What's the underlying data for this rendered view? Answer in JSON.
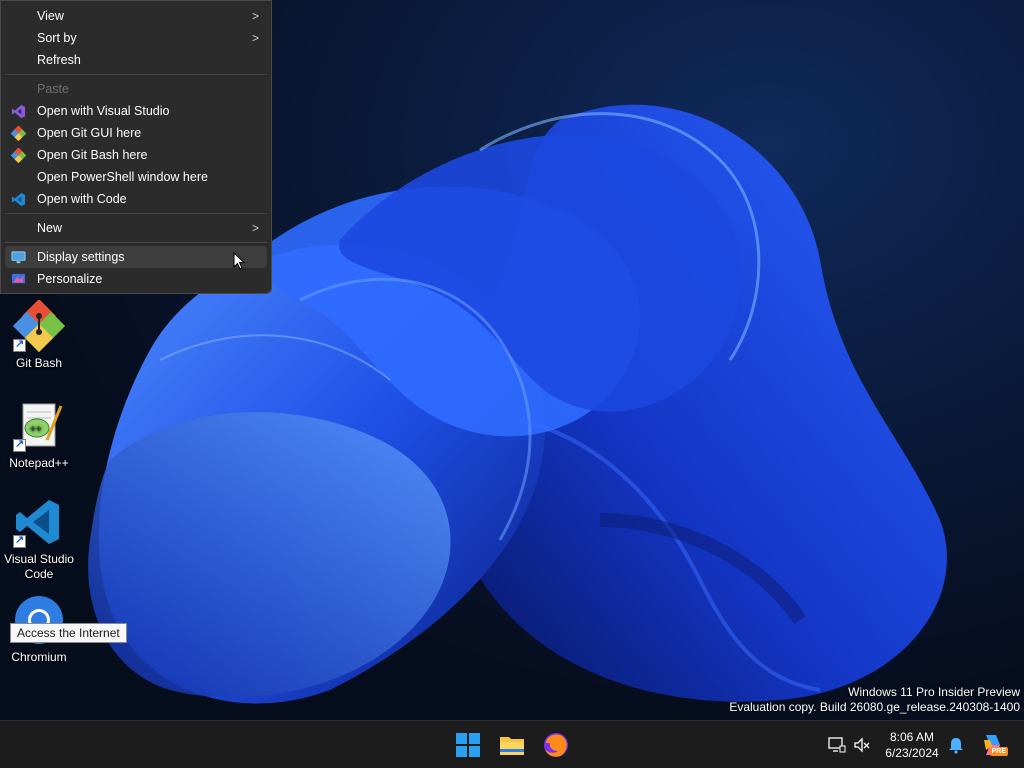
{
  "context_menu": {
    "items": [
      {
        "label": "View",
        "submenu": true
      },
      {
        "label": "Sort by",
        "submenu": true
      },
      {
        "label": "Refresh"
      },
      {
        "label": "Paste",
        "disabled": true
      },
      {
        "label": "Open with Visual Studio",
        "icon": "visual-studio-icon"
      },
      {
        "label": "Open Git GUI here",
        "icon": "git-icon"
      },
      {
        "label": "Open Git Bash here",
        "icon": "git-icon"
      },
      {
        "label": "Open PowerShell window here"
      },
      {
        "label": "Open with Code",
        "icon": "vscode-icon"
      },
      {
        "label": "New",
        "submenu": true
      },
      {
        "label": "Display settings",
        "icon": "display-icon",
        "hovered": true
      },
      {
        "label": "Personalize",
        "icon": "personalize-icon"
      }
    ],
    "submenu_arrow": ">"
  },
  "desktop_icons": [
    {
      "label": "Git Bash",
      "icon": "git-bash-icon"
    },
    {
      "label": "Notepad++",
      "icon": "notepad-plus-plus-icon"
    },
    {
      "label": "Visual Studio Code",
      "icon": "vscode-icon"
    },
    {
      "label": "Chromium",
      "icon": "chromium-icon"
    }
  ],
  "tooltip": "Access the Internet",
  "watermark": {
    "line1": "Windows 11 Pro Insider Preview",
    "line2": "Evaluation copy. Build 26080.ge_release.240308-1400"
  },
  "taskbar": {
    "pinned": [
      "start-icon",
      "file-explorer-icon",
      "firefox-icon"
    ],
    "tray": [
      "network-icon",
      "volume-muted-icon",
      "notification-bell-icon",
      "copilot-icon"
    ],
    "clock": {
      "time": "8:06 AM",
      "date": "6/23/2024"
    },
    "copilot_badge": "PRE"
  },
  "colors": {
    "menu_bg": "#2b2b2b",
    "taskbar_bg": "#1c1c1c",
    "accent": "#1a5fd8"
  }
}
